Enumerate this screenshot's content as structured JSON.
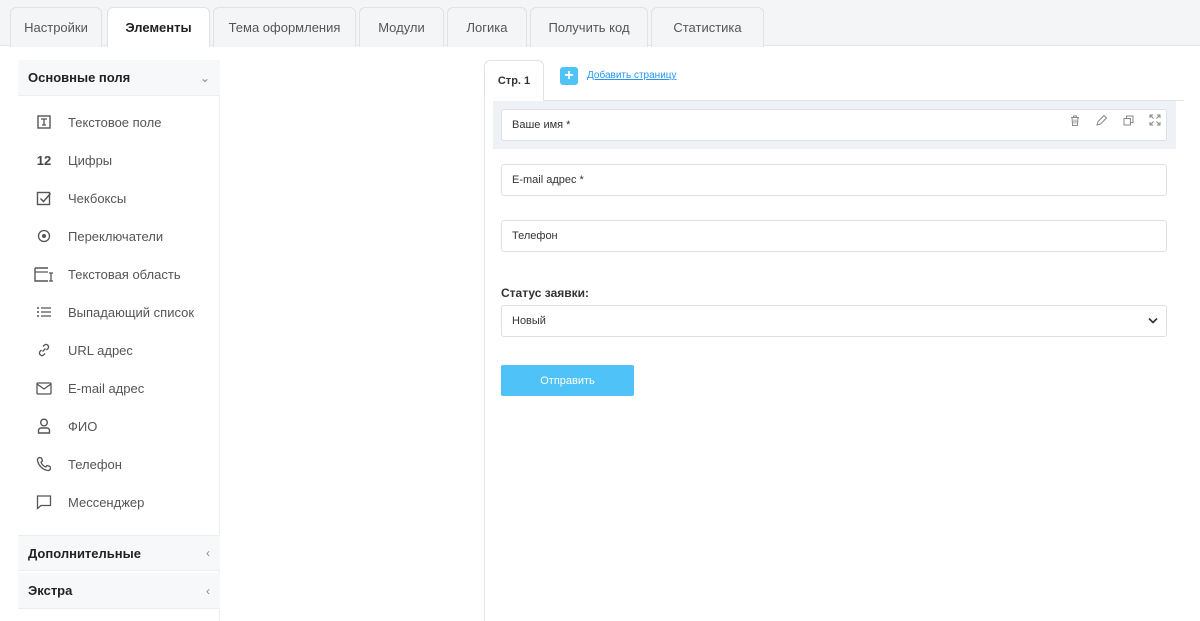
{
  "top_tabs": [
    {
      "label": "Настройки"
    },
    {
      "label": "Элементы"
    },
    {
      "label": "Тема оформления"
    },
    {
      "label": "Модули"
    },
    {
      "label": "Логика"
    },
    {
      "label": "Получить код"
    },
    {
      "label": "Статистика"
    }
  ],
  "active_tab": "Элементы",
  "sidebar": {
    "basic_title": "Основные поля",
    "items": [
      {
        "label": "Текстовое поле",
        "icon": "text-field-icon"
      },
      {
        "label": "Цифры",
        "icon": "numbers-icon",
        "icon_text": "12"
      },
      {
        "label": "Чекбоксы",
        "icon": "checkbox-icon"
      },
      {
        "label": "Переключатели",
        "icon": "radio-icon"
      },
      {
        "label": "Текстовая область",
        "icon": "textarea-icon"
      },
      {
        "label": "Выпадающий список",
        "icon": "list-icon"
      },
      {
        "label": "URL адрес",
        "icon": "link-icon"
      },
      {
        "label": "E-mail адрес",
        "icon": "envelope-icon"
      },
      {
        "label": "ФИО",
        "icon": "user-icon"
      },
      {
        "label": "Телефон",
        "icon": "phone-icon"
      },
      {
        "label": "Мессенджер",
        "icon": "chat-icon"
      }
    ],
    "extra_title": "Дополнительные",
    "extra2_title": "Экстра"
  },
  "pages": {
    "current_tab": "Стр. 1",
    "add_page": "Добавить страницу"
  },
  "form": {
    "name_placeholder": "Ваше имя *",
    "email_placeholder": "E-mail адрес *",
    "phone_placeholder": "Телефон",
    "status_label": "Статус заявки:",
    "status_value": "Новый",
    "submit_label": "Отправить"
  },
  "colors": {
    "accent": "#4fc3f7",
    "link": "#2196f3"
  }
}
